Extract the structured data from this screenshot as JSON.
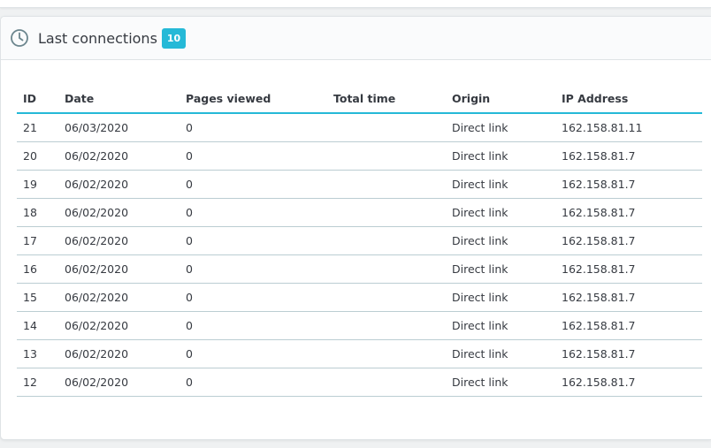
{
  "panel": {
    "title": "Last connections",
    "count_badge": "10",
    "icon": "clock-icon"
  },
  "table": {
    "headers": [
      "ID",
      "Date",
      "Pages viewed",
      "Total time",
      "Origin",
      "IP Address"
    ],
    "rows": [
      [
        "21",
        "06/03/2020",
        "0",
        "",
        "Direct link",
        "162.158.81.11"
      ],
      [
        "20",
        "06/02/2020",
        "0",
        "",
        "Direct link",
        "162.158.81.7"
      ],
      [
        "19",
        "06/02/2020",
        "0",
        "",
        "Direct link",
        "162.158.81.7"
      ],
      [
        "18",
        "06/02/2020",
        "0",
        "",
        "Direct link",
        "162.158.81.7"
      ],
      [
        "17",
        "06/02/2020",
        "0",
        "",
        "Direct link",
        "162.158.81.7"
      ],
      [
        "16",
        "06/02/2020",
        "0",
        "",
        "Direct link",
        "162.158.81.7"
      ],
      [
        "15",
        "06/02/2020",
        "0",
        "",
        "Direct link",
        "162.158.81.7"
      ],
      [
        "14",
        "06/02/2020",
        "0",
        "",
        "Direct link",
        "162.158.81.7"
      ],
      [
        "13",
        "06/02/2020",
        "0",
        "",
        "Direct link",
        "162.158.81.7"
      ],
      [
        "12",
        "06/02/2020",
        "0",
        "",
        "Direct link",
        "162.158.81.7"
      ]
    ]
  },
  "colors": {
    "accent": "#25b9d7",
    "text": "#363a41",
    "row_border": "#bbcdd2"
  }
}
